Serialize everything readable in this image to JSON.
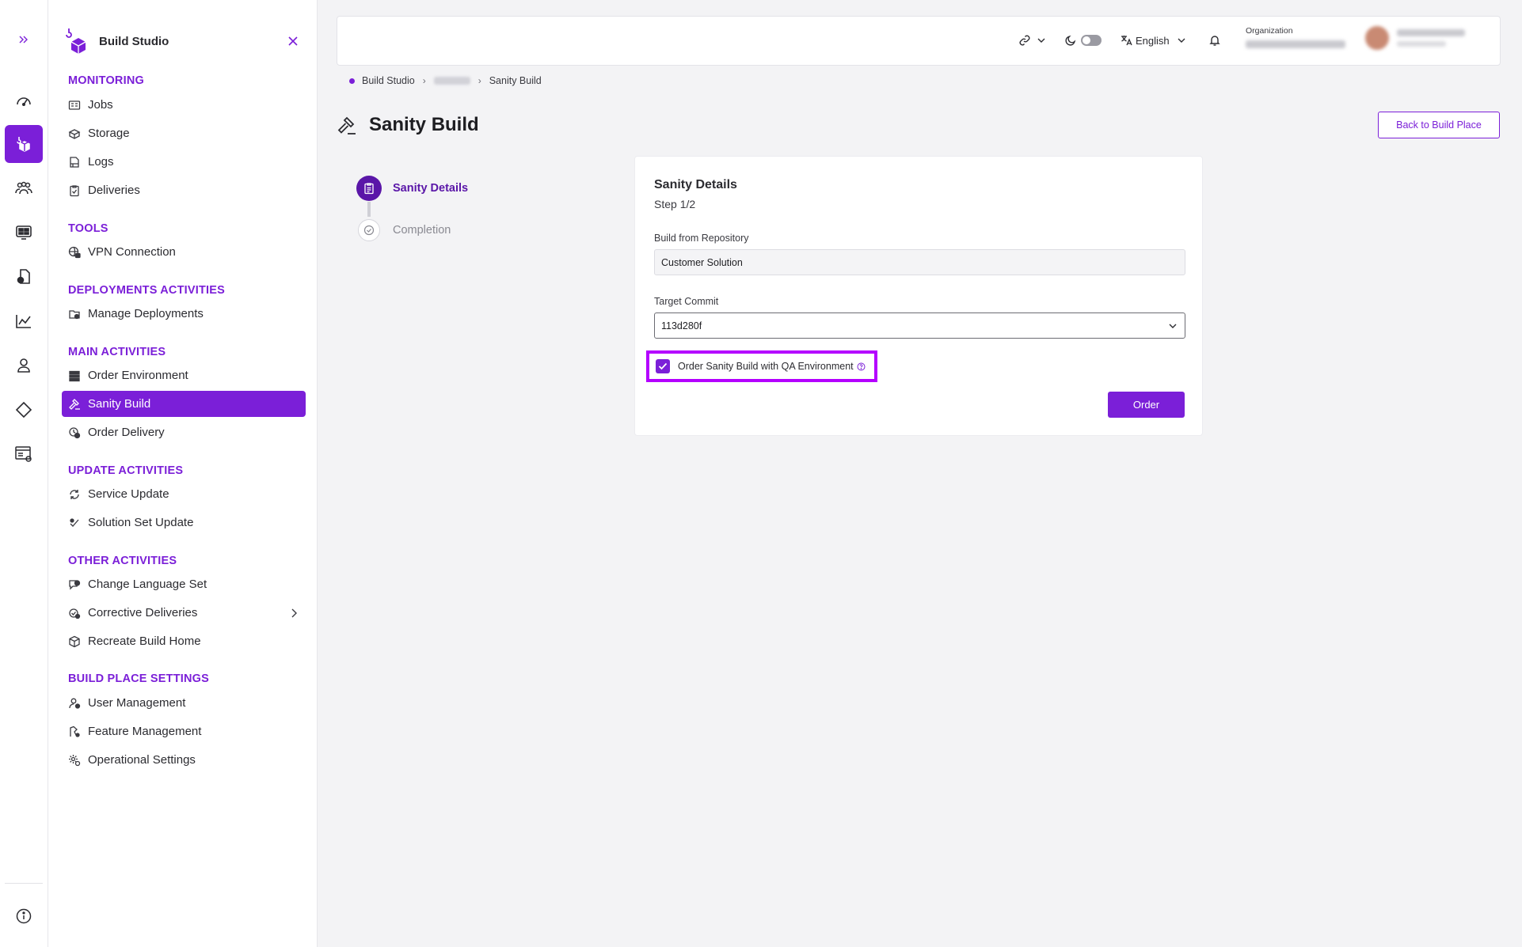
{
  "app": {
    "name": "Build Studio"
  },
  "rail": {
    "icons": [
      "expand-icon",
      "dashboard-icon",
      "build-studio-icon",
      "teams-icon",
      "monitor-icon",
      "files-icon",
      "analytics-icon",
      "user-icon",
      "diamond-icon",
      "settings-list-icon",
      "info-icon"
    ]
  },
  "sidebar": {
    "sections": [
      {
        "title": "MONITORING",
        "items": [
          {
            "label": "Jobs",
            "icon": "jobs-icon"
          },
          {
            "label": "Storage",
            "icon": "storage-icon"
          },
          {
            "label": "Logs",
            "icon": "logs-icon"
          },
          {
            "label": "Deliveries",
            "icon": "deliveries-icon"
          }
        ]
      },
      {
        "title": "TOOLS",
        "items": [
          {
            "label": "VPN Connection",
            "icon": "vpn-icon"
          }
        ]
      },
      {
        "title": "DEPLOYMENTS ACTIVITIES",
        "items": [
          {
            "label": "Manage Deployments",
            "icon": "deployments-icon"
          }
        ]
      },
      {
        "title": "MAIN ACTIVITIES",
        "items": [
          {
            "label": "Order Environment",
            "icon": "environment-icon"
          },
          {
            "label": "Sanity Build",
            "icon": "gavel-icon",
            "active": true
          },
          {
            "label": "Order Delivery",
            "icon": "delivery-icon"
          }
        ]
      },
      {
        "title": "UPDATE ACTIVITIES",
        "items": [
          {
            "label": "Service Update",
            "icon": "refresh-icon"
          },
          {
            "label": "Solution Set Update",
            "icon": "solution-icon"
          }
        ]
      },
      {
        "title": "OTHER ACTIVITIES",
        "items": [
          {
            "label": "Change Language Set",
            "icon": "language-icon"
          },
          {
            "label": "Corrective Deliveries",
            "icon": "corrective-icon",
            "has_submenu": true
          },
          {
            "label": "Recreate Build Home",
            "icon": "box-icon"
          }
        ]
      },
      {
        "title": "BUILD PLACE SETTINGS",
        "items": [
          {
            "label": "User Management",
            "icon": "user-management-icon"
          },
          {
            "label": "Feature Management",
            "icon": "feature-icon"
          },
          {
            "label": "Operational Settings",
            "icon": "gear-icon"
          }
        ]
      }
    ]
  },
  "topbar": {
    "language": "English",
    "organization_label": "Organization",
    "theme_toggle_on": false
  },
  "breadcrumb": {
    "root": "Build Studio",
    "current": "Sanity Build"
  },
  "page": {
    "title": "Sanity Build",
    "back_button": "Back to Build Place"
  },
  "stepper": {
    "steps": [
      {
        "label": "Sanity Details",
        "state": "active"
      },
      {
        "label": "Completion",
        "state": "todo"
      }
    ]
  },
  "form": {
    "title": "Sanity Details",
    "step": "Step 1/2",
    "repo_label": "Build from Repository",
    "repo_value": "Customer Solution",
    "commit_label": "Target Commit",
    "commit_value": "113d280f",
    "qa_checkbox_label": "Order Sanity Build with QA Environment",
    "qa_checked": true,
    "order_button": "Order"
  },
  "colors": {
    "accent": "#7b1fd8",
    "accent_dark": "#5a16a8",
    "highlight": "#b400ff"
  }
}
